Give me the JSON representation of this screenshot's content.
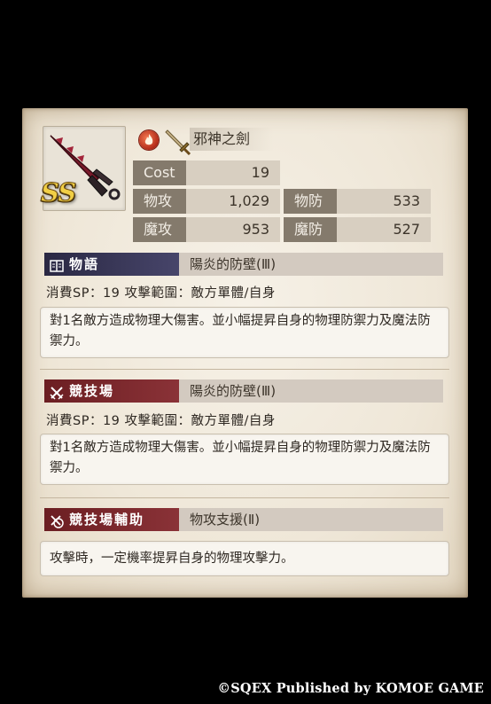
{
  "weapon": {
    "rarity": "SS",
    "name": "邪神之劍",
    "element_icon": "fire-element-icon",
    "type_icon": "sword-icon"
  },
  "stats": {
    "cost_label": "Cost",
    "cost_value": "19",
    "patk_label": "物攻",
    "patk_value": "1,029",
    "pdef_label": "物防",
    "pdef_value": "533",
    "matk_label": "魔攻",
    "matk_value": "953",
    "mdef_label": "魔防",
    "mdef_value": "527"
  },
  "sections": [
    {
      "tag": "物語",
      "icon": "book-icon",
      "skill": "陽炎的防壁(Ⅲ)",
      "cost_line": "消費SP：19  攻擊範圍：敵方單體/自身",
      "description": "對1名敵方造成物理大傷害。並小幅提昇自身的物理防禦力及魔法防禦力。"
    },
    {
      "tag": "競技場",
      "icon": "crossed-swords-icon",
      "skill": "陽炎的防壁(Ⅲ)",
      "cost_line": "消費SP：19  攻擊範圍：敵方單體/自身",
      "description": "對1名敵方造成物理大傷害。並小幅提昇自身的物理防禦力及魔法防禦力。"
    },
    {
      "tag": "競技場輔助",
      "icon": "crossed-swords-circle-icon",
      "skill": "物攻支援(Ⅱ)",
      "description": "攻擊時，一定機率提昇自身的物理攻擊力。"
    }
  ],
  "footer": {
    "copyright": "©SQEX Published by KOMOE GAME"
  },
  "colors": {
    "story_tag": "#2a2843",
    "arena_tag": "#6b1e22",
    "stat_label_bg": "#847a6c",
    "stat_value_bg": "#d8cfc1",
    "card_bg": "#f2ecdf"
  }
}
